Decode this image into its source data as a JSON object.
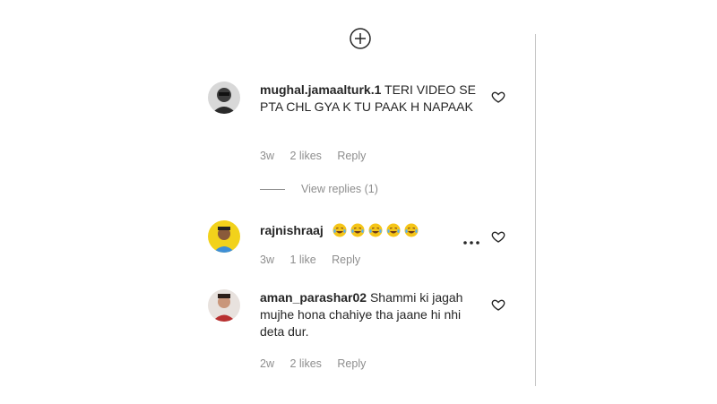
{
  "load_more_icon": "plus-circle-icon",
  "comments": [
    {
      "username": "mughal.jamaalturk.1",
      "text": "TERI VIDEO SE PTA CHL GYA K TU PAAK H NAPAAK",
      "time": "3w",
      "likes": "2 likes",
      "reply": "Reply",
      "avatar_icon": "avatar-photo",
      "view_replies": "View replies (1)"
    },
    {
      "username": "rajnishraaj",
      "text": "",
      "emoji_icons": [
        "laughing-tears-emoji",
        "laughing-tears-emoji",
        "laughing-tears-emoji",
        "laughing-tears-emoji",
        "laughing-tears-emoji"
      ],
      "time": "3w",
      "likes": "1 like",
      "reply": "Reply",
      "avatar_icon": "avatar-photo"
    },
    {
      "username": "aman_parashar02",
      "text": "Shammi ki jagah mujhe hona chahiye tha jaane hi nhi deta dur.",
      "time": "2w",
      "likes": "2 likes",
      "reply": "Reply",
      "avatar_icon": "avatar-photo"
    }
  ],
  "colors": {
    "text": "#262626",
    "secondary": "#8e8e8e",
    "divider": "#c7c7c7",
    "emoji": "#f5c518"
  }
}
